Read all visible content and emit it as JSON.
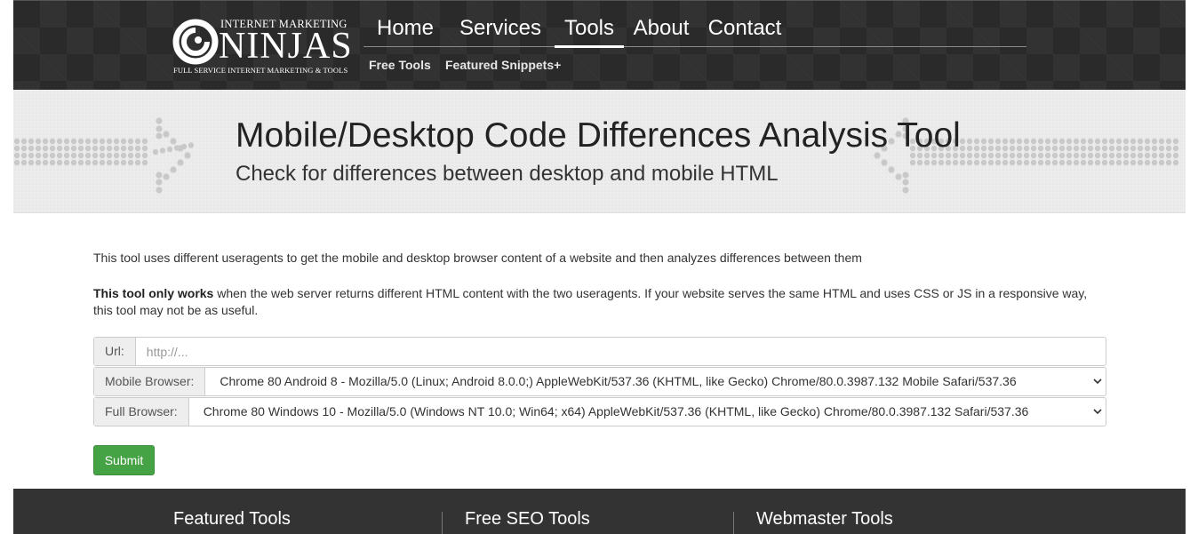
{
  "header": {
    "logo": {
      "top_text": "INTERNET MARKETING",
      "big_text": "NINJAS",
      "sub_text": "FULL SERVICE INTERNET MARKETING & TOOLS"
    },
    "nav": [
      {
        "label": "Home"
      },
      {
        "label": "Services"
      },
      {
        "label": "Tools",
        "active": true
      },
      {
        "label": "About"
      },
      {
        "label": "Contact"
      }
    ],
    "subnav": [
      {
        "label": "Free Tools"
      },
      {
        "label": "Featured Snippets+"
      }
    ]
  },
  "banner": {
    "title": "Mobile/Desktop Code Differences Analysis Tool",
    "subtitle": "Check for differences between desktop and mobile HTML"
  },
  "content": {
    "intro": "This tool uses different useragents to get the mobile and desktop browser content of a website and then analyzes differences between them",
    "note_bold": "This tool only works",
    "note_rest": " when the web server returns different HTML content with the two useragents. If your website serves the same HTML and uses CSS or JS in a responsive way, this tool may not be as useful."
  },
  "form": {
    "url_label": "Url:",
    "url_placeholder": "http://...",
    "url_value": "",
    "mobile_label": "Mobile Browser:",
    "mobile_value": "Chrome 80 Android 8 - Mozilla/5.0 (Linux; Android 8.0.0;) AppleWebKit/537.36 (KHTML, like Gecko) Chrome/80.0.3987.132 Mobile Safari/537.36",
    "full_label": "Full Browser:",
    "full_value": "Chrome 80 Windows 10 - Mozilla/5.0 (Windows NT 10.0; Win64; x64) AppleWebKit/537.36 (KHTML, like Gecko) Chrome/80.0.3987.132 Safari/537.36",
    "submit_label": "Submit"
  },
  "footer": {
    "columns": [
      {
        "heading": "Featured Tools"
      },
      {
        "heading": "Free SEO Tools"
      },
      {
        "heading": "Webmaster Tools"
      }
    ]
  },
  "colors": {
    "header_bg": "#2a2a2a",
    "banner_bg": "#ececec",
    "submit_green": "#45a245",
    "footer_bg": "#333333"
  },
  "icons": [
    "logo-mark-icon",
    "chevron-down-icon"
  ]
}
